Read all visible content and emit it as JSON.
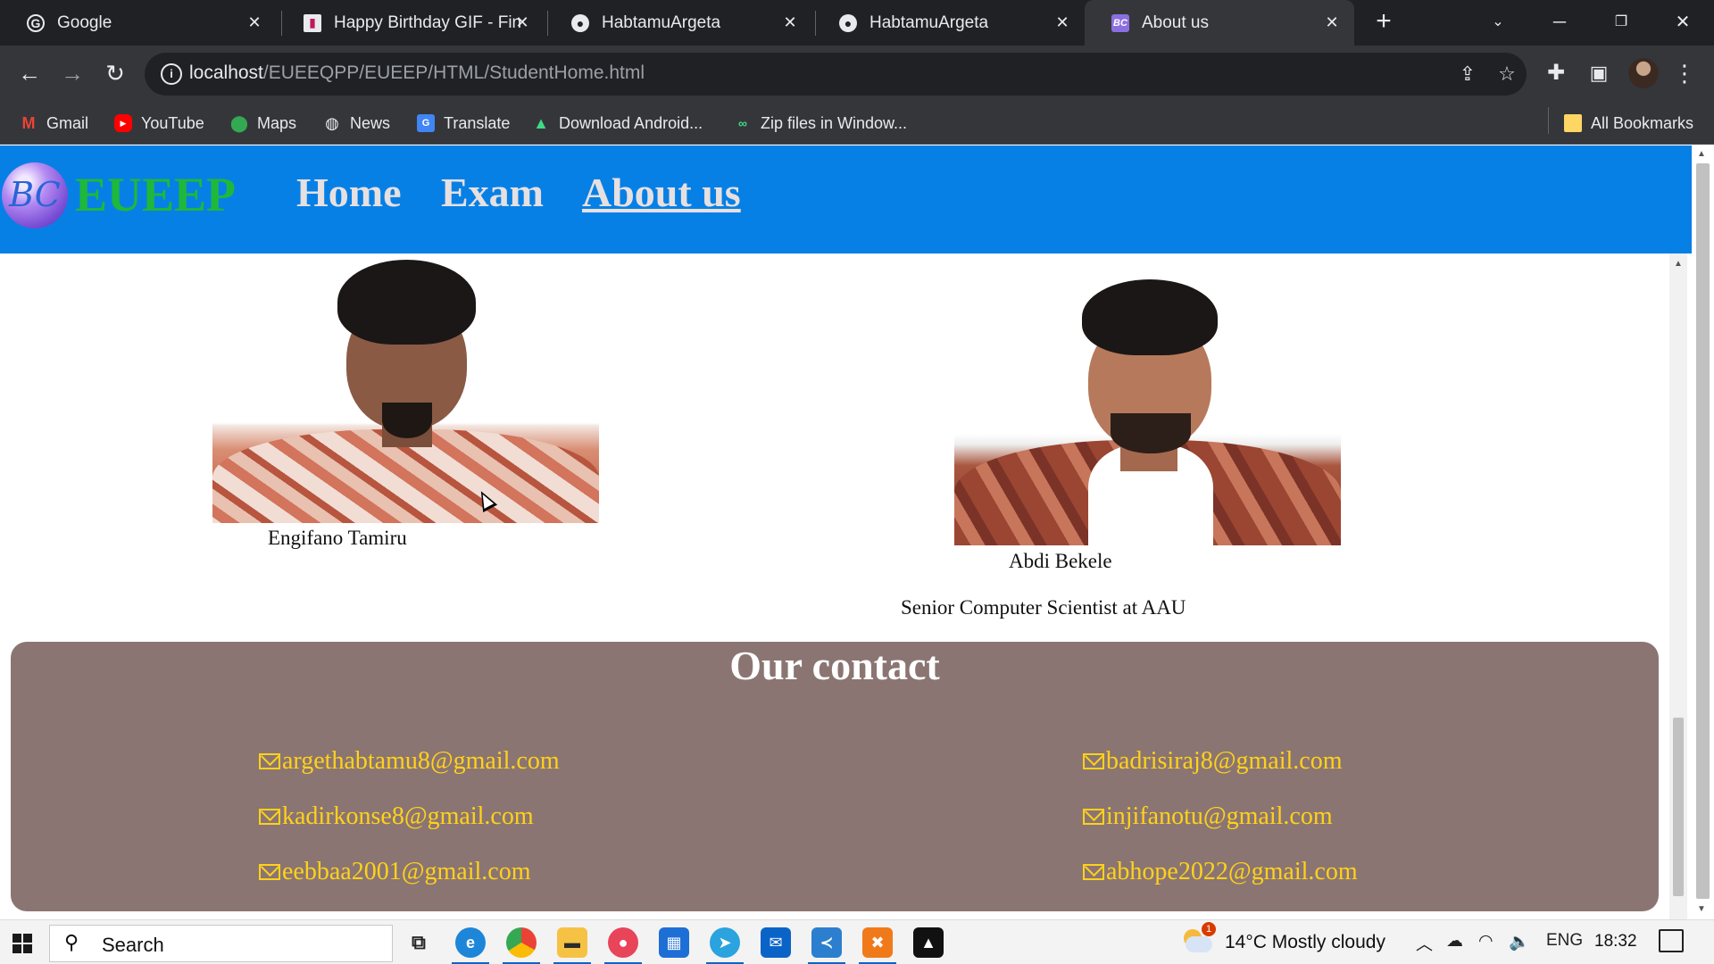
{
  "browser": {
    "tabs": [
      {
        "title": "Google",
        "icon": "google-icon",
        "active": false
      },
      {
        "title": "Happy Birthday GIF - Find",
        "icon": "giphy-icon",
        "active": false
      },
      {
        "title": "HabtamuArgeta",
        "icon": "github-icon",
        "active": false
      },
      {
        "title": "HabtamuArgeta",
        "icon": "github-icon",
        "active": false
      },
      {
        "title": "About us",
        "icon": "bc-icon",
        "active": true
      }
    ],
    "url_host": "localhost",
    "url_path": "/EUEEQPP/EUEEP/HTML/StudentHome.html",
    "bookmarks": [
      "Gmail",
      "YouTube",
      "Maps",
      "News",
      "Translate",
      "Download Android...",
      "Zip files in Window..."
    ],
    "all_bookmarks": "All Bookmarks"
  },
  "site": {
    "logo_initials": "BC",
    "logo_text": "EUEEP",
    "nav": [
      {
        "label": "Home",
        "current": false
      },
      {
        "label": "Exam",
        "current": false
      },
      {
        "label": "About us",
        "current": true
      }
    ],
    "colors": {
      "nav_bg": "#0780e6",
      "logo_green": "#1fb83a",
      "contact_bg": "#8b7572",
      "email_yellow": "#ffd21a"
    }
  },
  "team": [
    {
      "name": "Engifano Tamiru",
      "role": ""
    },
    {
      "name": "Abdi Bekele",
      "role": "Senior Computer Scientist at AAU"
    }
  ],
  "contact": {
    "title": "Our contact",
    "emails_left": [
      "argethabtamu8@gmail.com",
      "kadirkonse8@gmail.com",
      "eebbaa2001@gmail.com"
    ],
    "emails_right": [
      "badrisiraj8@gmail.com",
      "injifanotu@gmail.com",
      "abhope2022@gmail.com"
    ]
  },
  "taskbar": {
    "search_label": "Search",
    "weather": "14°C  Mostly cloudy",
    "weather_badge": "1",
    "language": "ENG",
    "time": "18:32"
  }
}
